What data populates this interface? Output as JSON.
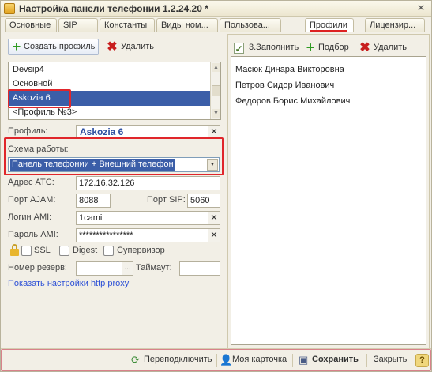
{
  "window": {
    "title": "Настройка панели телефонии 1.2.24.20 *",
    "close_glyph": "✕"
  },
  "tabs": [
    {
      "label": "Основные"
    },
    {
      "label": "SIP"
    },
    {
      "label": "Константы"
    },
    {
      "label": "Виды ном..."
    },
    {
      "label": "Пользова..."
    },
    {
      "label": "Профили"
    },
    {
      "label": "Лицензир..."
    }
  ],
  "active_tab": "Профили",
  "left_toolbar": {
    "create_label": "Создать профиль",
    "delete_label": "Удалить"
  },
  "profiles": [
    "Devsip4",
    "Основной",
    "Askozia 6",
    "<Профиль №3>"
  ],
  "selected_profile": "Askozia 6",
  "form": {
    "profile_label": "Профиль:",
    "profile_value": "Askozia 6",
    "scheme_label": "Схема работы:",
    "scheme_value": "Панель телефонии + Внешний телефон",
    "pbx_label": "Адрес АТС:",
    "pbx_value": "172.16.32.126",
    "ajam_port_label": "Порт AJAM:",
    "ajam_port_value": "8088",
    "sip_port_label": "Порт SIP:",
    "sip_port_value": "5060",
    "ami_login_label": "Логин AMI:",
    "ami_login_value": "1cami",
    "ami_password_label": "Пароль AMI:",
    "ami_password_value": "****************",
    "ssl_label": "SSL",
    "digest_label": "Digest",
    "supervisor_label": "Супервизор",
    "reserve_label": "Номер резерв:",
    "reserve_value": "",
    "timeout_label": "Таймаут:",
    "timeout_value": "",
    "proxy_link": "Показать настройки http proxy",
    "dots": "..."
  },
  "right_toolbar": {
    "fill_label": "3.Заполнить",
    "pick_label": "Подбор",
    "delete_label": "Удалить"
  },
  "users": [
    "Масюк Динара Викторовна",
    "Петров Сидор Иванович",
    "Федоров Борис Михайлович"
  ],
  "footer": {
    "reconnect_label": "Переподключить",
    "card_label": "Моя карточка",
    "save_label": "Сохранить",
    "close_label": "Закрыть",
    "help_label": "?"
  },
  "colors": {
    "selection": "#3b5ea8",
    "highlight_frame": "#e0262b",
    "link": "#2b4fd6"
  }
}
